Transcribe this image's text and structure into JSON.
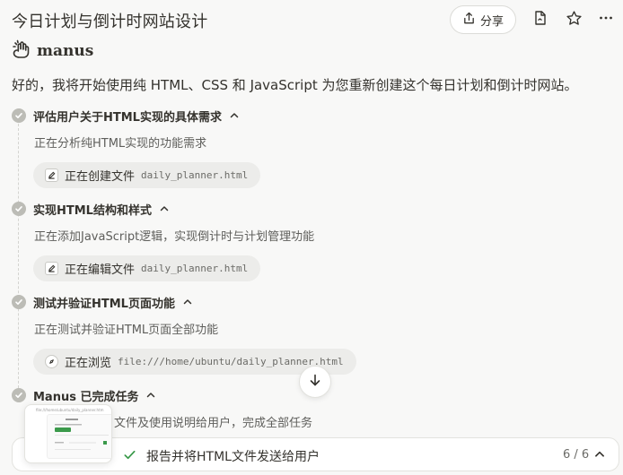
{
  "header": {
    "title": "今日计划与倒计时网站设计",
    "share_label": "分享"
  },
  "brand": {
    "name": "manus"
  },
  "intro": "好的，我将开始使用纯 HTML、CSS 和 JavaScript 为您重新创建这个每日计划和倒计时网站。",
  "steps": [
    {
      "title": "评估用户关于HTML实现的具体需求",
      "desc": "正在分析纯HTML实现的功能需求",
      "tool_label": "正在创建文件",
      "tool_target": "daily_planner.html",
      "tool_icon": "pencil-icon"
    },
    {
      "title": "实现HTML结构和样式",
      "desc": "正在添加JavaScript逻辑，实现倒计时与计划管理功能",
      "tool_label": "正在编辑文件",
      "tool_target": "daily_planner.html",
      "tool_icon": "pencil-icon"
    },
    {
      "title": "测试并验证HTML页面功能",
      "desc": "正在测试并验证HTML页面全部功能",
      "tool_label": "正在浏览",
      "tool_target": "file:///home/ubuntu/daily_planner.html",
      "tool_icon": "compass-icon"
    },
    {
      "title": "Manus 已完成任务",
      "desc": "文件及使用说明给用户，完成全部任务"
    }
  ],
  "bottom_bar": {
    "label": "报告并将HTML文件发送给用户",
    "count": "6 / 6"
  },
  "thumbnail": {
    "url": "file:///home/ubuntu/daily_planner.htm"
  },
  "colors": {
    "accent_green": "#3b9a4b",
    "check_gray": "#bcbcb6",
    "background": "#f8f8f7"
  }
}
